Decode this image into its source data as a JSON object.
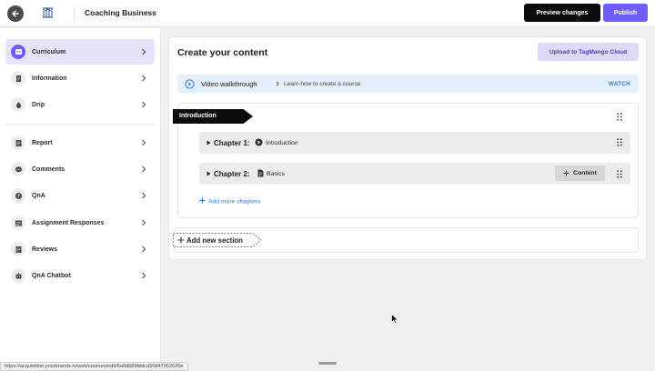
{
  "header": {
    "title": "Coaching Business",
    "preview_label": "Preview changes",
    "publish_label": "Publish"
  },
  "sidebar": {
    "items": [
      {
        "label": "Curriculum",
        "icon": "curriculum-icon",
        "active": true
      },
      {
        "label": "Information",
        "icon": "document-icon"
      },
      {
        "label": "Drip",
        "icon": "drip-icon"
      },
      {
        "label": "Report",
        "icon": "report-icon"
      },
      {
        "label": "Comments",
        "icon": "comment-icon"
      },
      {
        "label": "QnA",
        "icon": "question-icon"
      },
      {
        "label": "Assignment Responses",
        "icon": "assignment-icon"
      },
      {
        "label": "Reviews",
        "icon": "review-icon"
      },
      {
        "label": "QnA Chatbot",
        "icon": "chatbot-icon"
      }
    ]
  },
  "main": {
    "title": "Create your content",
    "upload_label": "Upload to TagMango Cloud",
    "walkthrough": {
      "title": "Video walkthrough",
      "subtitle": "Learn how to create a course",
      "action": "WATCH"
    },
    "section": {
      "name": "Introduction",
      "chapters": [
        {
          "label": "Chapter 1:",
          "name": "Introduction",
          "icon": "video-icon"
        },
        {
          "label": "Chapter 2:",
          "name": "Basics",
          "icon": "document-icon",
          "content_button": "Content"
        }
      ],
      "add_chapters_label": "Add more chapters"
    },
    "add_section_label": "Add new section"
  },
  "status_url": "https://acquisition.yourbrands.in/web/courses/edit/6a0d689fddca50d47052625e",
  "colors": {
    "accent": "#6d5dfc",
    "active_bg": "#e6e3fb",
    "link": "#2f7ad1",
    "walkthrough_bg": "#e3effa"
  }
}
